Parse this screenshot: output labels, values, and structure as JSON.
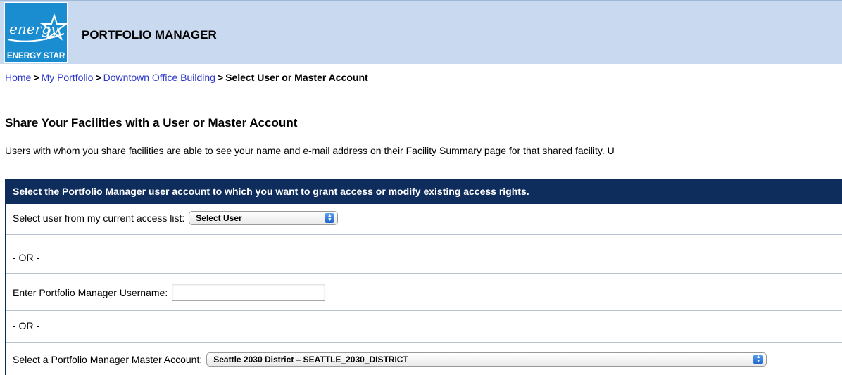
{
  "header": {
    "logo_text": "ENERGY STAR",
    "logo_script": "energy",
    "app_title": "PORTFOLIO MANAGER"
  },
  "breadcrumb": {
    "items": [
      "Home",
      "My Portfolio",
      "Downtown Office Building"
    ],
    "separator": ">",
    "current": "Select User or Master Account"
  },
  "page": {
    "title": "Share Your Facilities with a User or Master Account",
    "intro": "Users with whom you share facilities are able to see your name and e-mail address on their Facility Summary page for that shared facility. U"
  },
  "panel": {
    "header": "Select the Portfolio Manager user account to which you want to grant access or modify existing access rights.",
    "access_list_label": "Select user from my current access list:",
    "access_list_selected": "Select User",
    "or_1": "- OR -",
    "username_label": "Enter Portfolio Manager Username:",
    "username_value": "",
    "or_2": "- OR -",
    "master_label": "Select a Portfolio Manager Master Account:",
    "master_selected": "Seattle 2030 District – SEATTLE_2030_DISTRICT"
  },
  "colors": {
    "header_bg": "#c9daf0",
    "logo_blue": "#1a8dd1",
    "panel_header_bg": "#0f2d5c",
    "link": "#2a35c9"
  },
  "icons": [
    "energy-star-logo",
    "select-arrows-icon"
  ]
}
